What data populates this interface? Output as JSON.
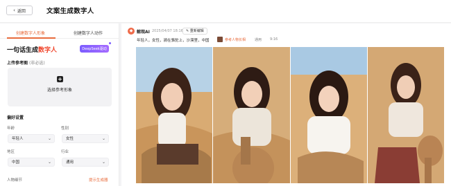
{
  "header": {
    "back_label": "返回",
    "title": "文案生成数字人"
  },
  "left_panel": {
    "tabs": [
      {
        "label": "创建数字人形象",
        "active": true
      },
      {
        "label": "创建数字人动作",
        "active": false
      }
    ],
    "headline_prefix": "一句话生成",
    "headline_highlight": "数字人",
    "deepseek_label": "DeepSeek驱动",
    "upload": {
      "label": "上传参考图",
      "optional": "(非必选)",
      "button_text": "选择参考形象"
    },
    "preferences": {
      "title": "偏好设置",
      "fields": [
        {
          "label": "年龄",
          "value": "年轻人"
        },
        {
          "label": "性别",
          "value": "女性"
        },
        {
          "label": "地区",
          "value": "中国"
        },
        {
          "label": "行业",
          "value": "通用"
        }
      ]
    },
    "detail_label": "人物细节",
    "generate_link": "提示生成器"
  },
  "result": {
    "brand": "鲸观AI",
    "timestamp": "2025/04/07 18:16",
    "reedit_label": "重新编辑",
    "prompt": "年轻人，女性，骑在骆驼上，沙漠里，中国",
    "reference_label": "参考人物长相",
    "meta_industry": "通用",
    "meta_ratio": "9:16",
    "images": [
      {
        "name": "result-image-1"
      },
      {
        "name": "result-image-2"
      },
      {
        "name": "result-image-3"
      },
      {
        "name": "result-image-4"
      }
    ]
  },
  "colors": {
    "accent": "#e86a3a",
    "highlight": "#f0442a",
    "deepseek": "#7b5cff",
    "logo": "#ef6b4a"
  },
  "icons": [
    "chevron-left-icon",
    "plus-icon",
    "chevron-down-icon",
    "logo-icon",
    "edit-icon"
  ]
}
